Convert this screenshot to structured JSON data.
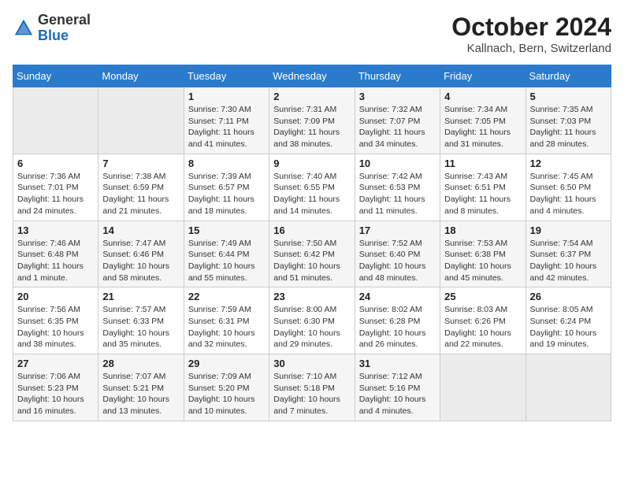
{
  "header": {
    "logo_general": "General",
    "logo_blue": "Blue",
    "title": "October 2024",
    "location": "Kallnach, Bern, Switzerland"
  },
  "days_of_week": [
    "Sunday",
    "Monday",
    "Tuesday",
    "Wednesday",
    "Thursday",
    "Friday",
    "Saturday"
  ],
  "weeks": [
    [
      {
        "day": "",
        "info": ""
      },
      {
        "day": "",
        "info": ""
      },
      {
        "day": "1",
        "info": "Sunrise: 7:30 AM\nSunset: 7:11 PM\nDaylight: 11 hours and 41 minutes."
      },
      {
        "day": "2",
        "info": "Sunrise: 7:31 AM\nSunset: 7:09 PM\nDaylight: 11 hours and 38 minutes."
      },
      {
        "day": "3",
        "info": "Sunrise: 7:32 AM\nSunset: 7:07 PM\nDaylight: 11 hours and 34 minutes."
      },
      {
        "day": "4",
        "info": "Sunrise: 7:34 AM\nSunset: 7:05 PM\nDaylight: 11 hours and 31 minutes."
      },
      {
        "day": "5",
        "info": "Sunrise: 7:35 AM\nSunset: 7:03 PM\nDaylight: 11 hours and 28 minutes."
      }
    ],
    [
      {
        "day": "6",
        "info": "Sunrise: 7:36 AM\nSunset: 7:01 PM\nDaylight: 11 hours and 24 minutes."
      },
      {
        "day": "7",
        "info": "Sunrise: 7:38 AM\nSunset: 6:59 PM\nDaylight: 11 hours and 21 minutes."
      },
      {
        "day": "8",
        "info": "Sunrise: 7:39 AM\nSunset: 6:57 PM\nDaylight: 11 hours and 18 minutes."
      },
      {
        "day": "9",
        "info": "Sunrise: 7:40 AM\nSunset: 6:55 PM\nDaylight: 11 hours and 14 minutes."
      },
      {
        "day": "10",
        "info": "Sunrise: 7:42 AM\nSunset: 6:53 PM\nDaylight: 11 hours and 11 minutes."
      },
      {
        "day": "11",
        "info": "Sunrise: 7:43 AM\nSunset: 6:51 PM\nDaylight: 11 hours and 8 minutes."
      },
      {
        "day": "12",
        "info": "Sunrise: 7:45 AM\nSunset: 6:50 PM\nDaylight: 11 hours and 4 minutes."
      }
    ],
    [
      {
        "day": "13",
        "info": "Sunrise: 7:46 AM\nSunset: 6:48 PM\nDaylight: 11 hours and 1 minute."
      },
      {
        "day": "14",
        "info": "Sunrise: 7:47 AM\nSunset: 6:46 PM\nDaylight: 10 hours and 58 minutes."
      },
      {
        "day": "15",
        "info": "Sunrise: 7:49 AM\nSunset: 6:44 PM\nDaylight: 10 hours and 55 minutes."
      },
      {
        "day": "16",
        "info": "Sunrise: 7:50 AM\nSunset: 6:42 PM\nDaylight: 10 hours and 51 minutes."
      },
      {
        "day": "17",
        "info": "Sunrise: 7:52 AM\nSunset: 6:40 PM\nDaylight: 10 hours and 48 minutes."
      },
      {
        "day": "18",
        "info": "Sunrise: 7:53 AM\nSunset: 6:38 PM\nDaylight: 10 hours and 45 minutes."
      },
      {
        "day": "19",
        "info": "Sunrise: 7:54 AM\nSunset: 6:37 PM\nDaylight: 10 hours and 42 minutes."
      }
    ],
    [
      {
        "day": "20",
        "info": "Sunrise: 7:56 AM\nSunset: 6:35 PM\nDaylight: 10 hours and 38 minutes."
      },
      {
        "day": "21",
        "info": "Sunrise: 7:57 AM\nSunset: 6:33 PM\nDaylight: 10 hours and 35 minutes."
      },
      {
        "day": "22",
        "info": "Sunrise: 7:59 AM\nSunset: 6:31 PM\nDaylight: 10 hours and 32 minutes."
      },
      {
        "day": "23",
        "info": "Sunrise: 8:00 AM\nSunset: 6:30 PM\nDaylight: 10 hours and 29 minutes."
      },
      {
        "day": "24",
        "info": "Sunrise: 8:02 AM\nSunset: 6:28 PM\nDaylight: 10 hours and 26 minutes."
      },
      {
        "day": "25",
        "info": "Sunrise: 8:03 AM\nSunset: 6:26 PM\nDaylight: 10 hours and 22 minutes."
      },
      {
        "day": "26",
        "info": "Sunrise: 8:05 AM\nSunset: 6:24 PM\nDaylight: 10 hours and 19 minutes."
      }
    ],
    [
      {
        "day": "27",
        "info": "Sunrise: 7:06 AM\nSunset: 5:23 PM\nDaylight: 10 hours and 16 minutes."
      },
      {
        "day": "28",
        "info": "Sunrise: 7:07 AM\nSunset: 5:21 PM\nDaylight: 10 hours and 13 minutes."
      },
      {
        "day": "29",
        "info": "Sunrise: 7:09 AM\nSunset: 5:20 PM\nDaylight: 10 hours and 10 minutes."
      },
      {
        "day": "30",
        "info": "Sunrise: 7:10 AM\nSunset: 5:18 PM\nDaylight: 10 hours and 7 minutes."
      },
      {
        "day": "31",
        "info": "Sunrise: 7:12 AM\nSunset: 5:16 PM\nDaylight: 10 hours and 4 minutes."
      },
      {
        "day": "",
        "info": ""
      },
      {
        "day": "",
        "info": ""
      }
    ]
  ]
}
